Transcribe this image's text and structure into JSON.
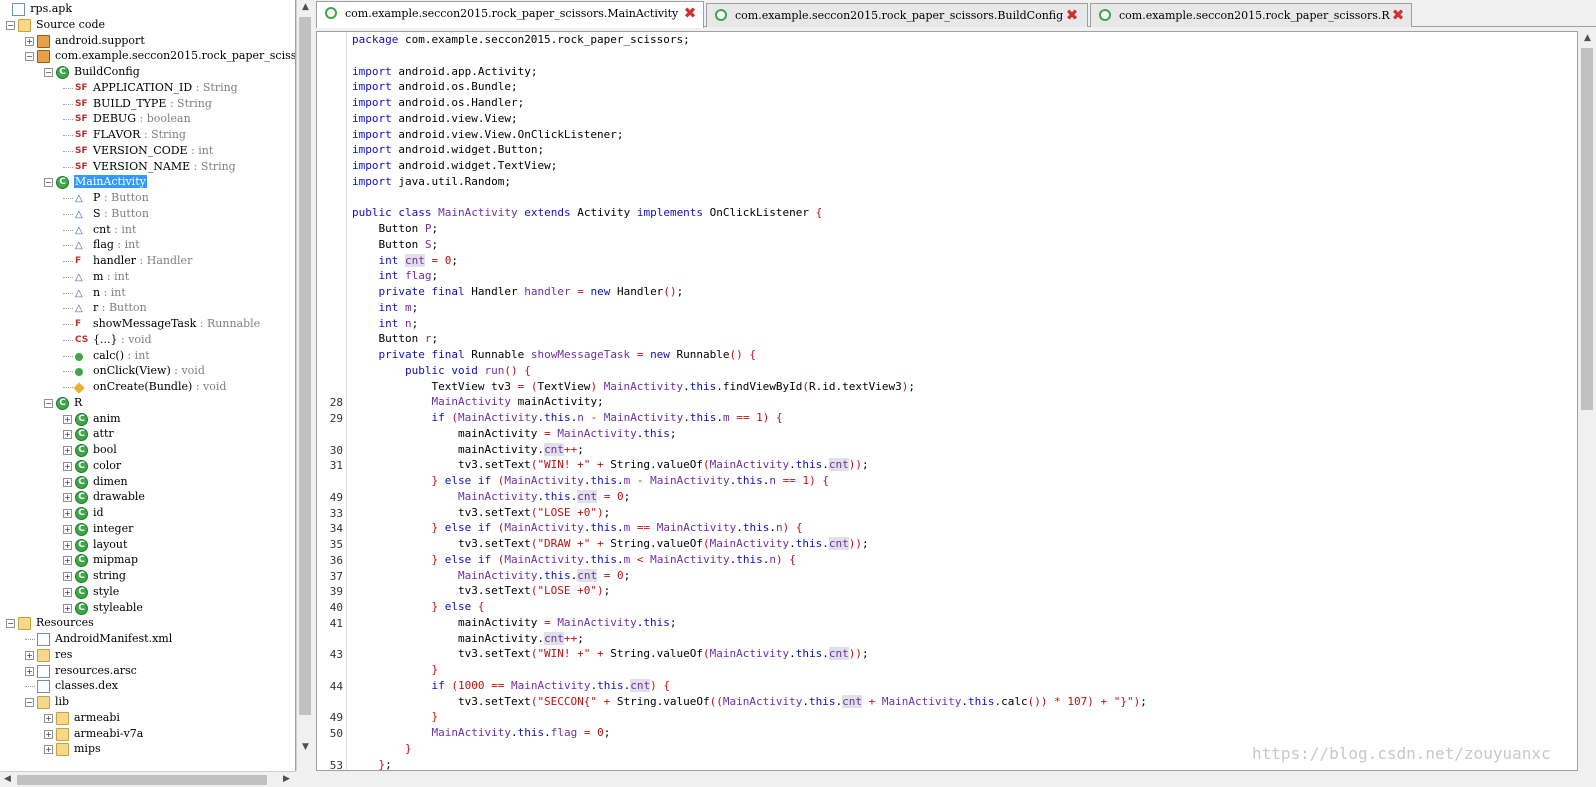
{
  "tree": {
    "root": "rps.apk",
    "source_code": "Source code",
    "pkg_android_support": "android.support",
    "pkg_main": "com.example.seccon2015.rock_paper_sciss",
    "buildconfig": {
      "name": "BuildConfig",
      "fields": [
        {
          "name": "APPLICATION_ID",
          "type": ": String"
        },
        {
          "name": "BUILD_TYPE",
          "type": ": String"
        },
        {
          "name": "DEBUG",
          "type": ": boolean"
        },
        {
          "name": "FLAVOR",
          "type": ": String"
        },
        {
          "name": "VERSION_CODE",
          "type": ": int"
        },
        {
          "name": "VERSION_NAME",
          "type": ": String"
        }
      ]
    },
    "mainactivity": {
      "name": "MainActivity",
      "members": [
        {
          "name": "P",
          "type": ": Button"
        },
        {
          "name": "S",
          "type": ": Button"
        },
        {
          "name": "cnt",
          "type": ": int"
        },
        {
          "name": "flag",
          "type": ": int"
        },
        {
          "name": "handler",
          "type": ": Handler"
        },
        {
          "name": "m",
          "type": ": int"
        },
        {
          "name": "n",
          "type": ": int"
        },
        {
          "name": "r",
          "type": ": Button"
        },
        {
          "name": "showMessageTask",
          "type": ": Runnable"
        },
        {
          "name": "{...}",
          "type": ": void"
        },
        {
          "name": "calc()",
          "type": ": int"
        },
        {
          "name": "onClick(View)",
          "type": ": void"
        },
        {
          "name": "onCreate(Bundle)",
          "type": ": void"
        }
      ]
    },
    "r_class": {
      "name": "R",
      "children": [
        "anim",
        "attr",
        "bool",
        "color",
        "dimen",
        "drawable",
        "id",
        "integer",
        "layout",
        "mipmap",
        "string",
        "style",
        "styleable"
      ]
    },
    "resources": {
      "name": "Resources",
      "children": [
        "AndroidManifest.xml",
        "res",
        "resources.arsc",
        "classes.dex",
        "lib"
      ],
      "lib_children": [
        "armeabi",
        "armeabi-v7a",
        "mips"
      ]
    }
  },
  "tabs": [
    {
      "label": "com.example.seccon2015.rock_paper_scissors.MainActivity"
    },
    {
      "label": "com.example.seccon2015.rock_paper_scissors.BuildConfig"
    },
    {
      "label": "com.example.seccon2015.rock_paper_scissors.R"
    }
  ],
  "code": {
    "line_numbers": [
      "",
      "",
      "",
      "",
      "",
      "",
      "",
      "",
      "",
      "",
      "",
      "",
      "",
      "",
      "",
      "",
      "",
      "",
      "",
      "",
      "",
      "",
      "",
      "28",
      "29",
      "",
      "30",
      "31",
      "",
      "49",
      "33",
      "34",
      "35",
      "36",
      "37",
      "39",
      "40",
      "41",
      "",
      "43",
      "",
      "44",
      "",
      "49",
      "50",
      "",
      "53",
      "",
      ""
    ],
    "lines": [
      "package com.example.seccon2015.rock_paper_scissors;",
      "",
      "import android.app.Activity;",
      "import android.os.Bundle;",
      "import android.os.Handler;",
      "import android.view.View;",
      "import android.view.View.OnClickListener;",
      "import android.widget.Button;",
      "import android.widget.TextView;",
      "import java.util.Random;",
      "",
      "public class MainActivity extends Activity implements OnClickListener {",
      "    Button P;",
      "    Button S;",
      "    int cnt = 0;",
      "    int flag;",
      "    private final Handler handler = new Handler();",
      "    int m;",
      "    int n;",
      "    Button r;",
      "    private final Runnable showMessageTask = new Runnable() {",
      "        public void run() {",
      "            TextView tv3 = (TextView) MainActivity.this.findViewById(R.id.textView3);",
      "            MainActivity mainActivity;",
      "            if (MainActivity.this.n - MainActivity.this.m == 1) {",
      "                mainActivity = MainActivity.this;",
      "                mainActivity.cnt++;",
      "                tv3.setText(\"WIN! +\" + String.valueOf(MainActivity.this.cnt));",
      "            } else if (MainActivity.this.m - MainActivity.this.n == 1) {",
      "                MainActivity.this.cnt = 0;",
      "                tv3.setText(\"LOSE +0\");",
      "            } else if (MainActivity.this.m == MainActivity.this.n) {",
      "                tv3.setText(\"DRAW +\" + String.valueOf(MainActivity.this.cnt));",
      "            } else if (MainActivity.this.m < MainActivity.this.n) {",
      "                MainActivity.this.cnt = 0;",
      "                tv3.setText(\"LOSE +0\");",
      "            } else {",
      "                mainActivity = MainActivity.this;",
      "                mainActivity.cnt++;",
      "                tv3.setText(\"WIN! +\" + String.valueOf(MainActivity.this.cnt));",
      "            }",
      "            if (1000 == MainActivity.this.cnt) {",
      "                tv3.setText(\"SECCON{\" + String.valueOf((MainActivity.this.cnt + MainActivity.this.calc()) * 107) + \"}\");",
      "            }",
      "            MainActivity.this.flag = 0;",
      "        }",
      "    };"
    ]
  },
  "watermark": "https://blog.csdn.net/zouyuanxc",
  "colors": {
    "keyword": "#1010c0",
    "identifier": "#7030a0",
    "string": "#c01010",
    "selection": "#3399ff"
  }
}
